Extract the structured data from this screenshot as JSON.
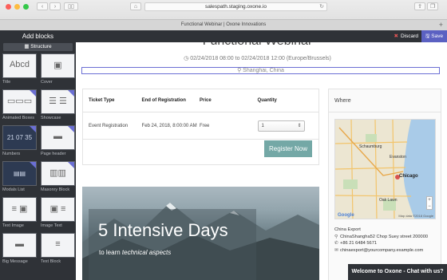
{
  "browser": {
    "url": "salespath.staging.oxone.io",
    "tab_title": "Functional Webinar | Oxone Innovations",
    "colors": {
      "close": "#fc605b",
      "minimize": "#fdbc40",
      "maximize": "#34c84a"
    }
  },
  "editor": {
    "panel_title": "Add blocks",
    "structure_label": "Structure",
    "discard_label": "Discard",
    "save_label": "Save",
    "accent_color": "#5b61c2",
    "blocks": [
      {
        "label": "Title",
        "icon": "title-text-icon",
        "glyph": "Abcd"
      },
      {
        "label": "Cover",
        "icon": "camera-icon",
        "glyph": "📷"
      },
      {
        "label": "Animated Boxes",
        "icon": "animated-boxes-icon",
        "glyph": "▦"
      },
      {
        "label": "Showcase",
        "icon": "showcase-icon",
        "glyph": "☰"
      },
      {
        "label": "Numbers",
        "icon": "numbers-icon",
        "glyph": "21 07 35"
      },
      {
        "label": "Page header",
        "icon": "page-header-icon",
        "glyph": "▭"
      },
      {
        "label": "Modals List",
        "icon": "modals-list-icon",
        "glyph": "▤"
      },
      {
        "label": "Masonry Block",
        "icon": "masonry-icon",
        "glyph": "▥"
      },
      {
        "label": "Text Image",
        "icon": "text-image-icon",
        "glyph": "≡ 📷"
      },
      {
        "label": "Image Text",
        "icon": "image-text-icon",
        "glyph": "📷 ≡"
      },
      {
        "label": "Big Message",
        "icon": "big-message-icon",
        "glyph": "▬"
      },
      {
        "label": "Text Block",
        "icon": "text-block-icon",
        "glyph": "≡"
      }
    ]
  },
  "event": {
    "title": "Functional Webinar",
    "date": "02/24/2018 08:00 to 02/24/2018 12:00 (Europe/Brussels)",
    "location": "Shanghai, China"
  },
  "tickets": {
    "headers": [
      "Ticket Type",
      "End of Registration",
      "Price",
      "Quantity"
    ],
    "rows": [
      {
        "type": "Event Registration",
        "end": "Feb 24, 2018, 8:00:00 AM",
        "price": "Free",
        "quantity": "1"
      }
    ],
    "register_label": "Register Now"
  },
  "where": {
    "heading": "Where",
    "map_credit": "Map data ©2018 Google",
    "map_labels": [
      "Schaumburg",
      "Evanston",
      "Chicago",
      "Oak Lawn"
    ],
    "company": "China Export",
    "address": "ChinaShangha52 Chop Suey street 200000",
    "phone": "+86 21 6484 5671",
    "email": "chinaexport@yourcompany.example.com"
  },
  "hero": {
    "title": "5 Intensive Days",
    "subtitle_prefix": "to learn ",
    "subtitle_emphasis": "technical aspects"
  },
  "chat": {
    "label": "Welcome to Oxone - Chat with us?"
  }
}
